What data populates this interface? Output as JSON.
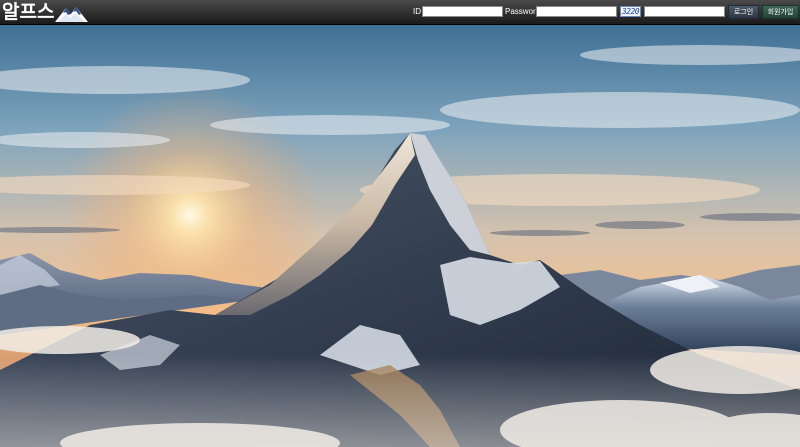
{
  "header": {
    "logo_text": "알프스",
    "id_label": "ID",
    "id_value": "",
    "password_label": "Password",
    "password_value": "",
    "captcha_text": "3220",
    "captcha_input_value": "",
    "login_button": "로그인",
    "signup_button": "회원가입"
  },
  "colors": {
    "topbar": "#2a2a2a",
    "login_button": "#3a4654",
    "signup_button": "#2f5446",
    "sky_top": "#3e6f93",
    "horizon_glow": "#f7c98a"
  },
  "icons": {
    "logo_mark": "mountain-icon"
  }
}
